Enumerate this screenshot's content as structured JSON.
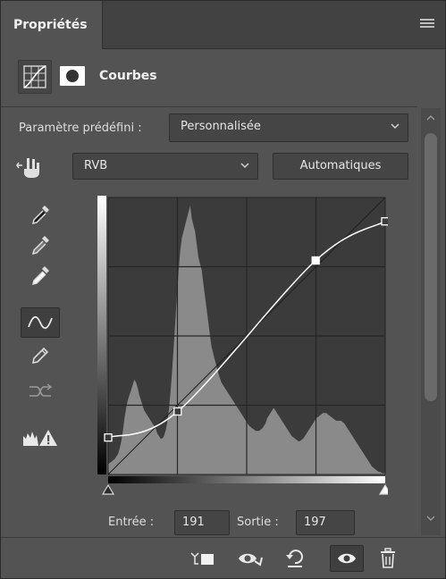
{
  "tab": {
    "label": "Propriétés"
  },
  "header": {
    "title": "Courbes",
    "adjustment_icon": "curves-adjustment-icon",
    "mask_icon": "layer-mask-icon"
  },
  "preset": {
    "label": "Paramètre prédéfini :",
    "value": "Personnalisée"
  },
  "channel": {
    "value": "RVB"
  },
  "auto_button": {
    "label": "Automatiques"
  },
  "tools": [
    {
      "name": "sample-black-eyedropper-icon"
    },
    {
      "name": "sample-gray-eyedropper-icon"
    },
    {
      "name": "sample-white-eyedropper-icon"
    },
    {
      "name": "curve-edit-points-icon",
      "active": true
    },
    {
      "name": "pencil-draw-icon"
    },
    {
      "name": "smooth-curve-icon"
    },
    {
      "name": "clipping-warning-icon"
    }
  ],
  "curve": {
    "points": [
      [
        0,
        34
      ],
      [
        64,
        58
      ],
      [
        191,
        197
      ],
      [
        255,
        233
      ]
    ],
    "selected_point": [
      191,
      197
    ],
    "histogram": [
      8,
      9,
      10,
      11,
      12,
      14,
      16,
      20,
      26,
      34,
      44,
      52,
      58,
      62,
      66,
      70,
      74,
      72,
      68,
      62,
      58,
      54,
      50,
      48,
      46,
      44,
      42,
      40,
      38,
      36,
      32,
      30,
      28,
      28,
      30,
      34,
      40,
      50,
      64,
      80,
      100,
      120,
      140,
      160,
      175,
      185,
      190,
      195,
      200,
      205,
      210,
      200,
      195,
      190,
      180,
      170,
      165,
      160,
      150,
      140,
      130,
      120,
      110,
      100,
      95,
      90,
      85,
      80,
      76,
      72,
      70,
      68,
      66,
      64,
      62,
      60,
      58,
      56,
      54,
      52,
      50,
      48,
      46,
      44,
      42,
      40,
      38,
      37,
      36,
      35,
      34,
      34,
      34,
      35,
      36,
      38,
      40,
      44,
      46,
      48,
      50,
      52,
      50,
      48,
      46,
      44,
      42,
      40,
      38,
      36,
      34,
      32,
      30,
      29,
      28,
      27,
      26,
      26,
      27,
      28,
      30,
      32,
      34,
      36,
      38,
      40,
      42,
      44,
      45,
      46,
      47,
      48,
      48,
      48,
      47,
      46,
      45,
      44,
      43,
      42,
      42,
      42,
      42,
      41,
      40,
      38,
      36,
      34,
      32,
      30,
      28,
      26,
      24,
      22,
      20,
      18,
      16,
      14,
      12,
      10,
      8,
      6,
      5,
      4,
      3,
      2,
      2,
      1,
      1,
      1
    ]
  },
  "entree": {
    "label": "Entrée :",
    "value": "191"
  },
  "sortie": {
    "label": "Sortie :",
    "value": "197"
  },
  "footer": {
    "clip_to_layer": "clip-to-layer-icon",
    "view_previous": "view-previous-state-icon",
    "reset": "reset-adjustment-icon",
    "visibility": "toggle-visibility-icon",
    "delete": "delete-adjustment-icon"
  }
}
